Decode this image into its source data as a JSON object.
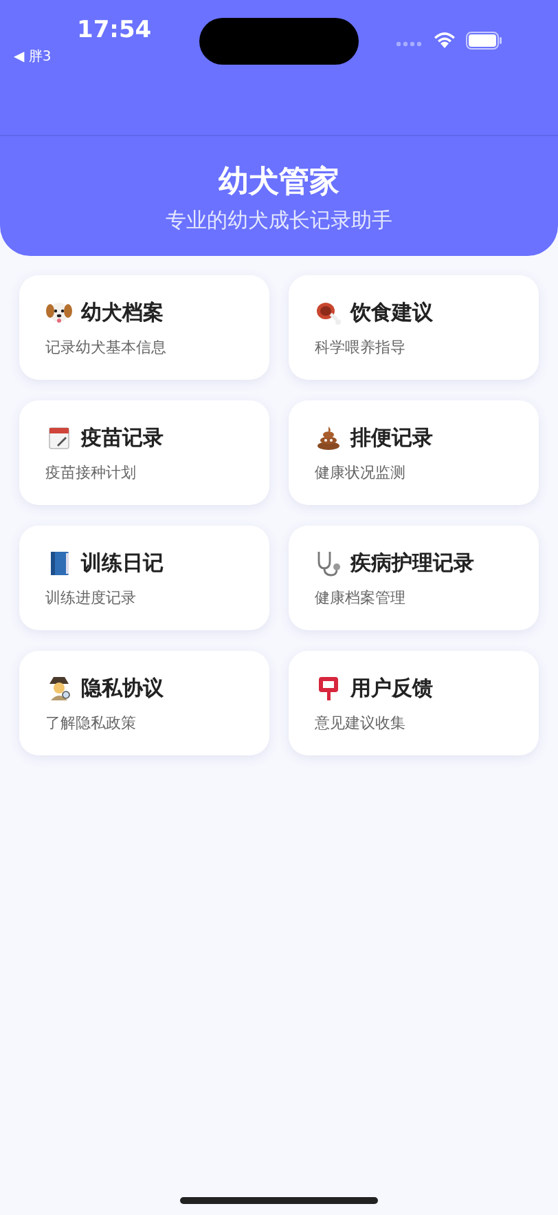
{
  "status_bar": {
    "time": "17:54",
    "back_label": "◀ 胖3"
  },
  "header": {
    "title": "幼犬管家",
    "subtitle": "专业的幼犬成长记录助手"
  },
  "cards": [
    {
      "title": "幼犬档案",
      "subtitle": "记录幼犬基本信息"
    },
    {
      "title": "饮食建议",
      "subtitle": "科学喂养指导"
    },
    {
      "title": "疫苗记录",
      "subtitle": "疫苗接种计划"
    },
    {
      "title": "排便记录",
      "subtitle": "健康状况监测"
    },
    {
      "title": "训练日记",
      "subtitle": "训练进度记录"
    },
    {
      "title": "疾病护理记录",
      "subtitle": "健康档案管理"
    },
    {
      "title": "隐私协议",
      "subtitle": "了解隐私政策"
    },
    {
      "title": "用户反馈",
      "subtitle": "意见建议收集"
    }
  ]
}
